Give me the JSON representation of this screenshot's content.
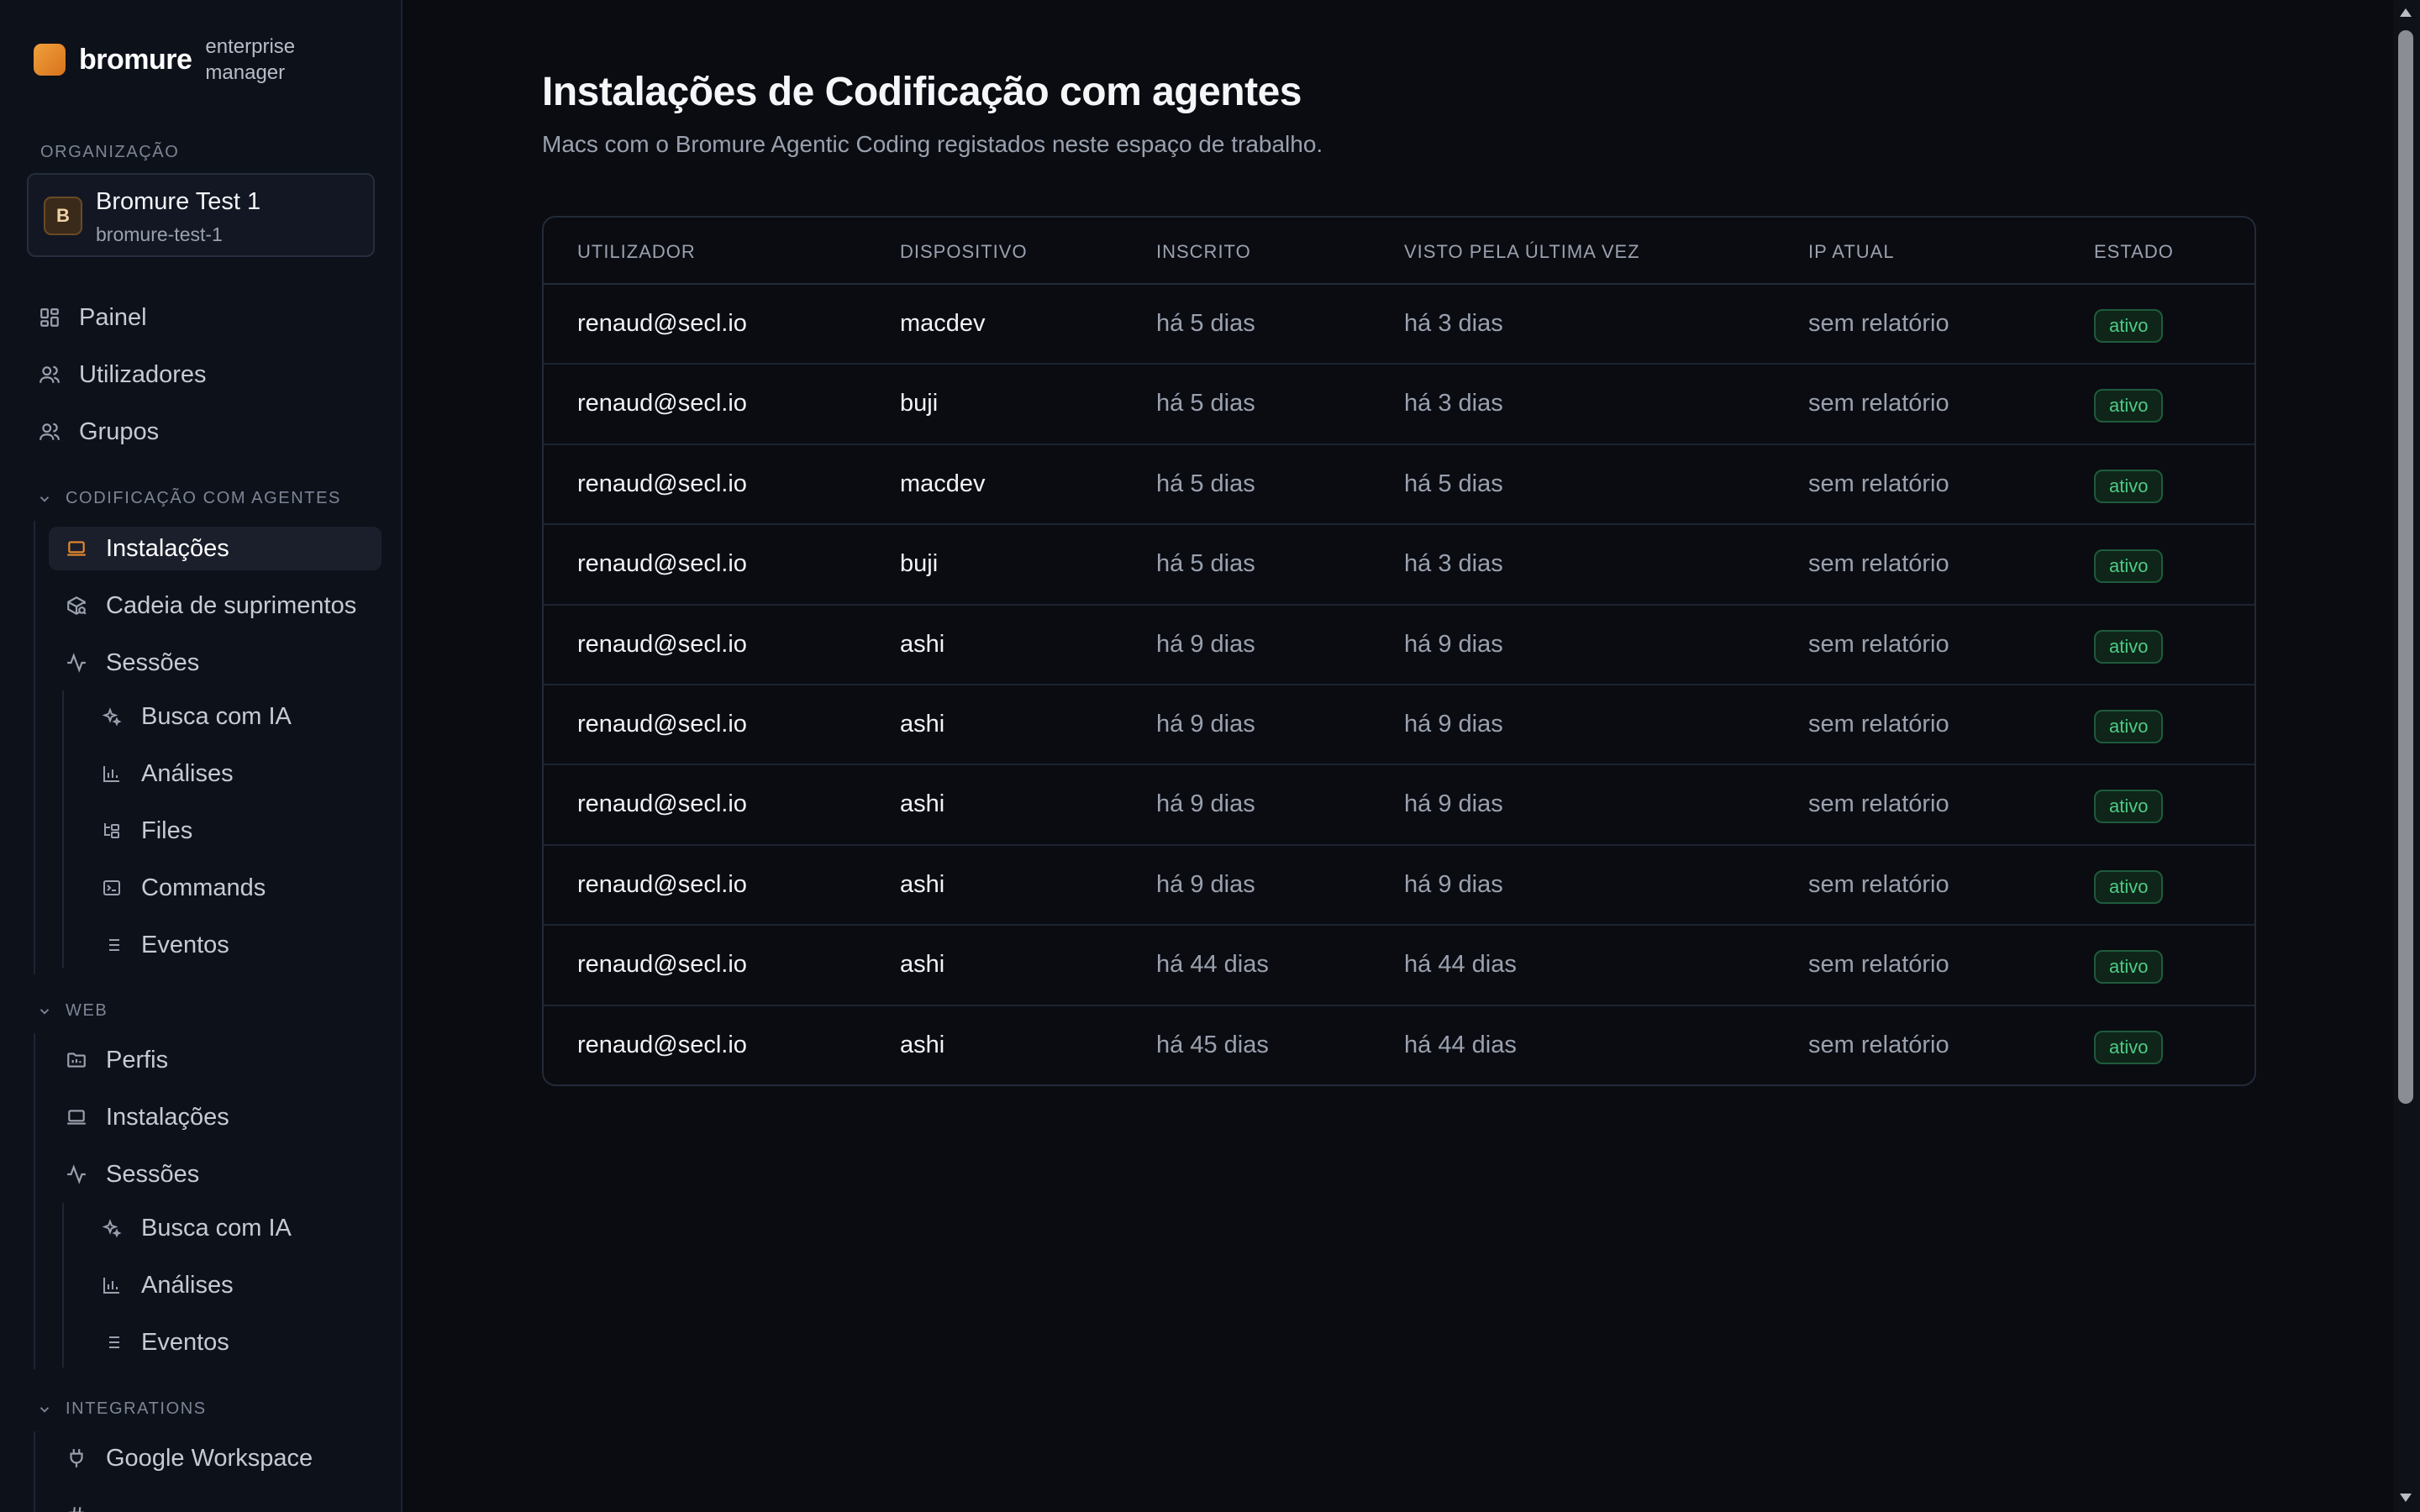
{
  "brand": {
    "name": "bromure",
    "subtitle": "enterprise manager"
  },
  "organization": {
    "section_label": "ORGANIZAÇÃO",
    "avatar_letter": "B",
    "name": "Bromure Test 1",
    "slug": "bromure-test-1"
  },
  "nav": {
    "painel": "Painel",
    "utilizadores": "Utilizadores",
    "grupos": "Grupos"
  },
  "coding_group": {
    "label": "CODIFICAÇÃO COM AGENTES",
    "instalacoes": "Instalações",
    "cadeia": "Cadeia de suprimentos",
    "sessoes": "Sessões",
    "busca": "Busca com IA",
    "analises": "Análises",
    "files": "Files",
    "commands": "Commands",
    "eventos": "Eventos"
  },
  "web_group": {
    "label": "WEB",
    "perfis": "Perfis",
    "instalacoes": "Instalações",
    "sessoes": "Sessões",
    "busca": "Busca com IA",
    "analises": "Análises",
    "eventos": "Eventos"
  },
  "integrations_group": {
    "label": "INTEGRATIONS",
    "google": "Google Workspace"
  },
  "page": {
    "title": "Instalações de Codificação com agentes",
    "subtitle": "Macs com o Bromure Agentic Coding registados neste espaço de trabalho."
  },
  "table": {
    "columns": [
      "UTILIZADOR",
      "DISPOSITIVO",
      "INSCRITO",
      "VISTO PELA ÚLTIMA VEZ",
      "IP ATUAL",
      "ESTADO"
    ],
    "rows": [
      [
        "renaud@secl.io",
        "macdev",
        "há 5 dias",
        "há 3 dias",
        "sem relatório",
        "ativo"
      ],
      [
        "renaud@secl.io",
        "buji",
        "há 5 dias",
        "há 3 dias",
        "sem relatório",
        "ativo"
      ],
      [
        "renaud@secl.io",
        "macdev",
        "há 5 dias",
        "há 5 dias",
        "sem relatório",
        "ativo"
      ],
      [
        "renaud@secl.io",
        "buji",
        "há 5 dias",
        "há 3 dias",
        "sem relatório",
        "ativo"
      ],
      [
        "renaud@secl.io",
        "ashi",
        "há 9 dias",
        "há 9 dias",
        "sem relatório",
        "ativo"
      ],
      [
        "renaud@secl.io",
        "ashi",
        "há 9 dias",
        "há 9 dias",
        "sem relatório",
        "ativo"
      ],
      [
        "renaud@secl.io",
        "ashi",
        "há 9 dias",
        "há 9 dias",
        "sem relatório",
        "ativo"
      ],
      [
        "renaud@secl.io",
        "ashi",
        "há 9 dias",
        "há 9 dias",
        "sem relatório",
        "ativo"
      ],
      [
        "renaud@secl.io",
        "ashi",
        "há 44 dias",
        "há 44 dias",
        "sem relatório",
        "ativo"
      ],
      [
        "renaud@secl.io",
        "ashi",
        "há 45 dias",
        "há 44 dias",
        "sem relatório",
        "ativo"
      ]
    ]
  },
  "colors": {
    "accent": "#e8892c",
    "status_active": "#4ecb86",
    "background": "#0a0c12"
  }
}
